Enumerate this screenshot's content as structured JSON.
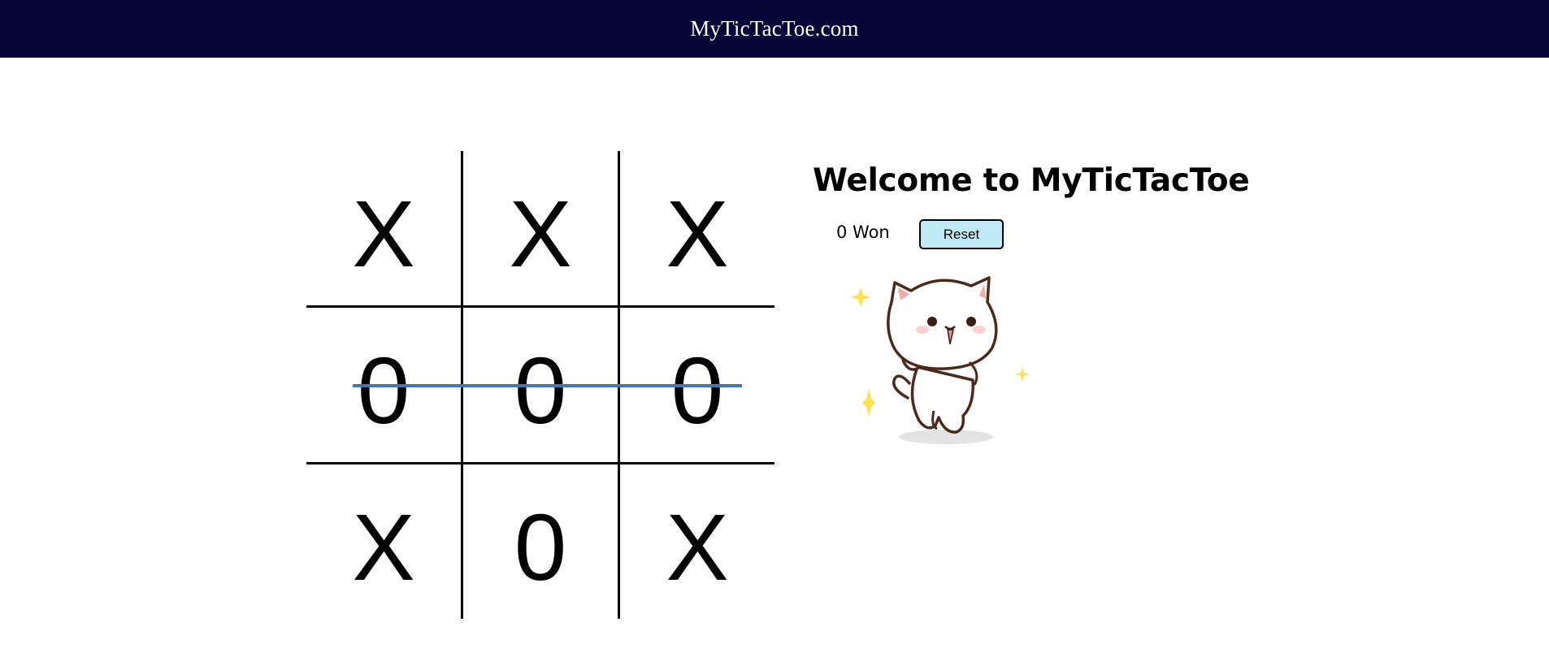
{
  "header": {
    "title": "MyTicTacToe.com",
    "background": "#050637"
  },
  "board": {
    "cells": [
      "X",
      "X",
      "X",
      "0",
      "0",
      "0",
      "X",
      "0",
      "X"
    ],
    "winning_row": "middle",
    "win_line_color": "#4278ac"
  },
  "panel": {
    "welcome": "Welcome to MyTicTacToe",
    "won_text": "0 Won",
    "reset_label": "Reset",
    "reset_color": "#bfe9f6",
    "image_icon": "happy-cat-sticker-icon"
  }
}
